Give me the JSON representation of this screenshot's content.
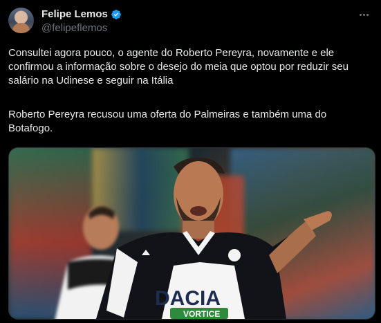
{
  "author": {
    "display_name": "Felipe Lemos",
    "handle": "@felipeflemos"
  },
  "tweet": {
    "paragraph1": "Consultei agora pouco, o agente do Roberto Pereyra, novamente e ele confirmou a informação sobre o desejo do meia que optou por reduzir seu salário na Udinese e seguir na Itália",
    "paragraph2": "Roberto Pereyra recusou uma oferta do Palmeiras e também uma do Botafogo."
  },
  "media": {
    "jersey_sponsor": "DACIA",
    "jersey_sleeve": "VORTICE"
  },
  "icons": {
    "verified": "verified-badge-icon",
    "more": "more-options-icon"
  },
  "colors": {
    "background": "#000000",
    "text": "#e7e9ea",
    "muted": "#71767b",
    "verified": "#1d9bf0"
  }
}
